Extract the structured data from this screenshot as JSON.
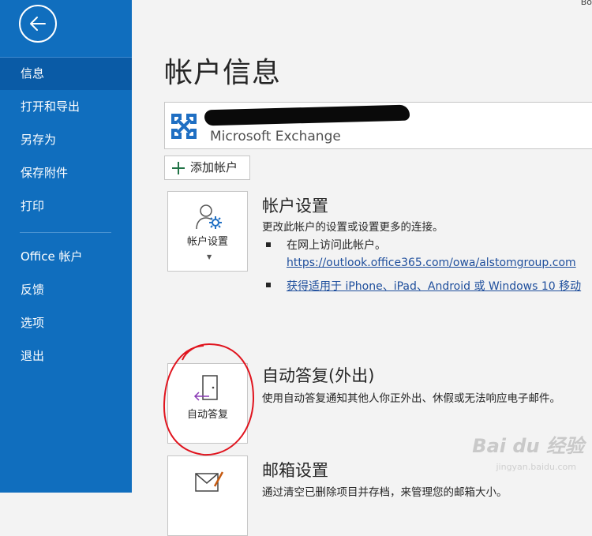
{
  "sidebar": {
    "items": [
      {
        "label": "信息",
        "active": true
      },
      {
        "label": "打开和导出"
      },
      {
        "label": "另存为"
      },
      {
        "label": "保存附件"
      },
      {
        "label": "打印"
      },
      {
        "label": "Office 帐户"
      },
      {
        "label": "反馈"
      },
      {
        "label": "选项"
      },
      {
        "label": "退出"
      }
    ]
  },
  "top_right": "Bo",
  "main": {
    "title": "帐户信息",
    "account": {
      "type": "Microsoft Exchange"
    },
    "add_account_label": "添加帐户",
    "account_settings": {
      "tile_label": "帐户设置",
      "title": "帐户设置",
      "desc": "更改此帐户的设置或设置更多的连接。",
      "bullet1": "在网上访问此帐户。",
      "link1": "https://outlook.office365.com/owa/alstomgroup.com",
      "link2": "获得适用于 iPhone、iPad、Android 或 Windows 10 移动"
    },
    "auto_reply": {
      "tile_label": "自动答复",
      "title": "自动答复(外出)",
      "desc": "使用自动答复通知其他人你正外出、休假或无法响应电子邮件。"
    },
    "mailbox": {
      "title": "邮箱设置",
      "desc": "通过清空已删除项目并存档，来管理您的邮箱大小。"
    }
  },
  "watermark": {
    "text": "Bai du 经验",
    "sub": "jingyan.baidu.com"
  },
  "colors": {
    "sidebar": "#106ebe",
    "active": "#0a5ba6",
    "accent_green": "#217346",
    "link": "#1e4e9c",
    "annotation_red": "#e0141e"
  }
}
